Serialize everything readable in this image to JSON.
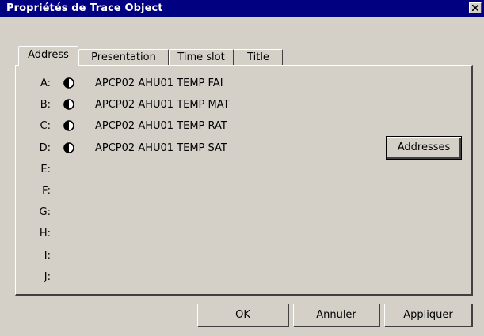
{
  "window": {
    "title": "Propriétés de Trace Object",
    "close_label": "×"
  },
  "tabs": [
    {
      "label": "Address",
      "active": true
    },
    {
      "label": "Presentation",
      "active": false
    },
    {
      "label": "Time slot",
      "active": false
    },
    {
      "label": "Title",
      "active": false
    }
  ],
  "traces": [
    {
      "letter": "A:",
      "icon": "half-filled-circle-icon",
      "name": "APCP02 AHU01 TEMP FAI"
    },
    {
      "letter": "B:",
      "icon": "half-filled-circle-icon",
      "name": "APCP02 AHU01 TEMP MAT"
    },
    {
      "letter": "C:",
      "icon": "half-filled-circle-icon",
      "name": "APCP02 AHU01 TEMP RAT"
    },
    {
      "letter": "D:",
      "icon": "half-filled-circle-icon",
      "name": "APCP02 AHU01 TEMP SAT"
    },
    {
      "letter": "E:",
      "icon": "",
      "name": ""
    },
    {
      "letter": "F:",
      "icon": "",
      "name": ""
    },
    {
      "letter": "G:",
      "icon": "",
      "name": ""
    },
    {
      "letter": "H:",
      "icon": "",
      "name": ""
    },
    {
      "letter": "I:",
      "icon": "",
      "name": ""
    },
    {
      "letter": "J:",
      "icon": "",
      "name": ""
    }
  ],
  "buttons": {
    "addresses": "Addresses",
    "ok": "OK",
    "cancel": "Annuler",
    "apply": "Appliquer"
  },
  "colors": {
    "titlebar": "#000080",
    "face": "#d4d0c8"
  }
}
